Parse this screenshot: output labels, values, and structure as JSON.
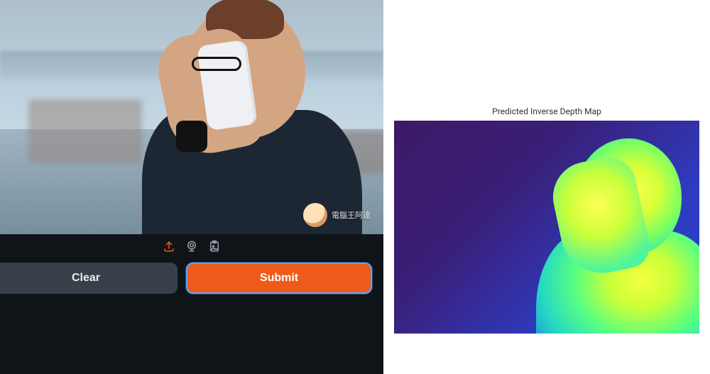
{
  "controls": {
    "clear_label": "Clear",
    "submit_label": "Submit"
  },
  "toolbar_icons": {
    "upload": "upload-icon",
    "webcam": "webcam-icon",
    "clipboard": "clipboard-image-icon"
  },
  "input_image": {
    "watermark_text": "電腦王阿達"
  },
  "output": {
    "title": "Predicted Inverse Depth Map"
  },
  "colors": {
    "submit_bg": "#ee5a1a",
    "submit_focus_ring": "#5aa7ff",
    "clear_bg": "#3a4049",
    "upload_icon": "#ee5a1a",
    "icon_gray": "#9aa1ab"
  }
}
